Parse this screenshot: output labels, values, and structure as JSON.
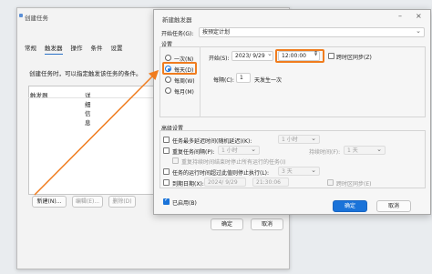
{
  "back_window": {
    "title": "创建任务",
    "tabs": [
      "常规",
      "触发器",
      "操作",
      "条件",
      "设置"
    ],
    "description": "创建任务时，可以指定触发该任务的条件。",
    "list_headers": [
      "触发器",
      "详细信息"
    ],
    "buttons": {
      "new": "新建(N)...",
      "edit": "编辑(E)...",
      "delete": "删除(D)"
    },
    "ok": "确定",
    "cancel": "取消"
  },
  "dialog": {
    "title": "新建触发器",
    "begin_task_label": "开始任务(G):",
    "begin_task_value": "按预定计划",
    "settings_label": "设置",
    "schedule_options": [
      "一次(N)",
      "每天(D)",
      "每周(W)",
      "每月(M)"
    ],
    "selected_option": "每天(D)",
    "start_label": "开始(S):",
    "start_date": "2023/ 9/29",
    "start_time": "12:00:00",
    "sync_timezone": "跨时区同步(Z)",
    "recur_label": "每隔(C):",
    "recur_value": "1",
    "recur_suffix": "天发生一次",
    "advanced_label": "高级设置",
    "delay_label": "任务最多延迟时间(随机延迟)(K):",
    "delay_value": "1 小时",
    "repeat_label": "重复任务间隔(P):",
    "repeat_value": "1 小时",
    "duration_label": "持续时间(F):",
    "duration_value": "1 天",
    "stop_repeat_label": "重复持续时间结束时停止所有运行的任务(I)",
    "stop_long_label": "任务的运行时间超过此值则停止执行(L):",
    "stop_long_value": "3 天",
    "expire_label": "到期日期(X):",
    "expire_date": "2024/ 9/29",
    "expire_time": "21:30:06",
    "expire_sync": "跨时区同步(E)",
    "enabled_label": "已启用(B)",
    "ok": "确定",
    "cancel": "取消",
    "accent_color": "#1a73d9",
    "highlight_color": "#f07c1e"
  }
}
